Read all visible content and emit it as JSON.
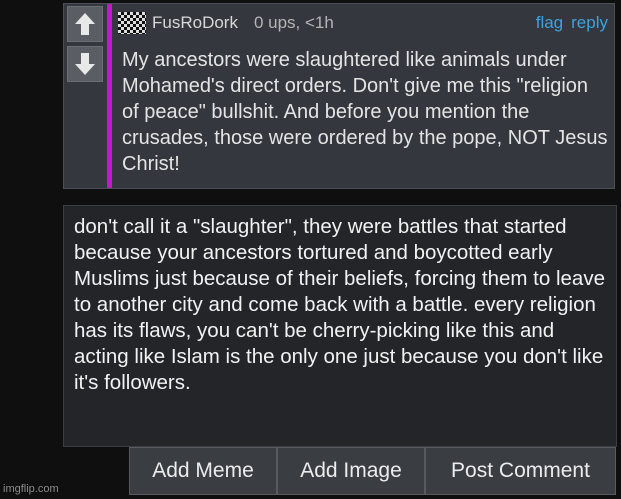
{
  "parent_comment": {
    "username": "FusRoDork",
    "stats": "0 ups, <1h",
    "actions": [
      "flag",
      "reply"
    ],
    "text": "My ancestors were slaughtered like animals under Mohamed's direct orders. Don't give me this \"religion of peace\" bullshit. And before you mention the crusades, those were ordered by the pope, NOT Jesus Christ!",
    "accent_color": "#c01ad0",
    "link_color": "#3ea2e0"
  },
  "reply_box": {
    "text": "don't call it a \"slaughter\", they were battles that started because your ancestors tortured and boycotted early Muslims just because of their beliefs, forcing them to leave to another city and come back with a battle. every religion has its flaws, you can't be cherry-picking like this and acting like Islam is the only one just because you don't like it's followers."
  },
  "buttons": {
    "add_meme": "Add Meme",
    "add_image": "Add Image",
    "post_comment": "Post Comment"
  },
  "watermark": "imgflip.com"
}
